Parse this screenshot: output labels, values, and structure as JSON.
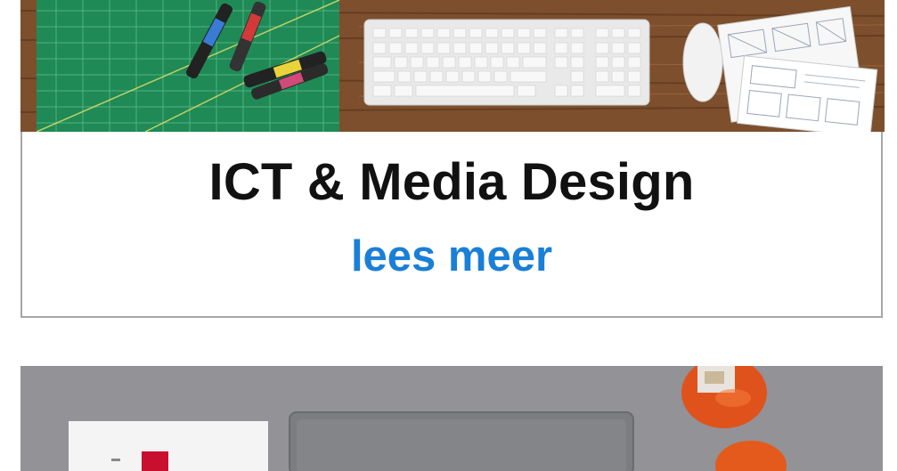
{
  "cards": [
    {
      "title": "ICT & Media Design",
      "link_label": "lees meer",
      "image_alt": "Bureau met snijmat, stiften, toetsenbord, muis en wireframe-schetsen"
    },
    {
      "image_alt": "Grijs bureau met laptop, notitieblok en oranje flessen"
    }
  ],
  "colors": {
    "link": "#1a7fd6",
    "title": "#111111",
    "card_border": "#a6a6a6"
  }
}
